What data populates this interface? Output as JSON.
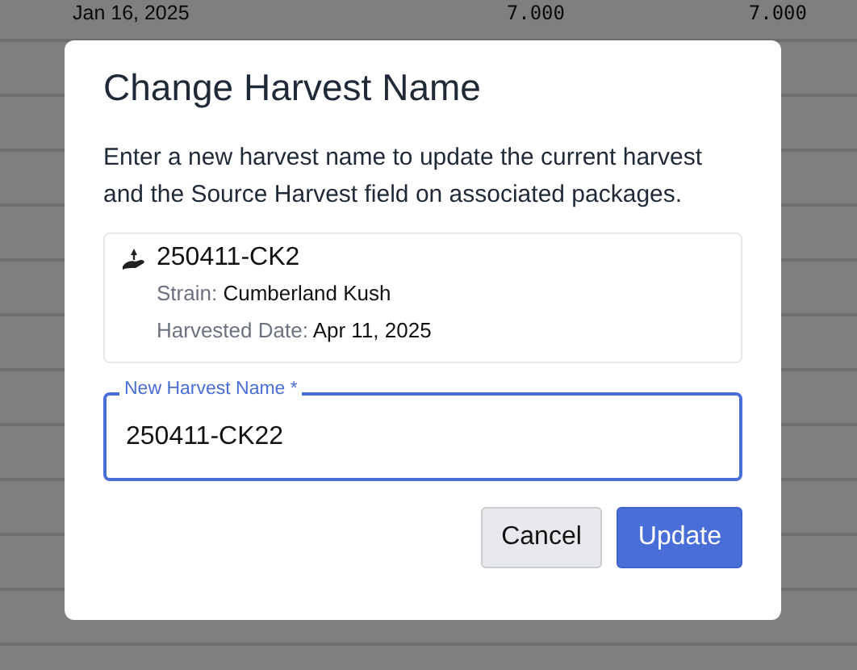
{
  "background_table": {
    "rows": [
      {
        "date": "Jan 16, 2025",
        "column_2": "7.000",
        "column_3": "7.000"
      }
    ]
  },
  "dialog": {
    "title": "Change Harvest Name",
    "description": "Enter a new harvest name to update the current harvest and the Source Harvest field on associated packages.",
    "harvest": {
      "name": "250411-CK2",
      "details": [
        {
          "label": "Strain:",
          "value": "Cumberland Kush"
        },
        {
          "label": "Harvested Date:",
          "value": "Apr 11, 2025"
        }
      ]
    },
    "field": {
      "label": "New Harvest Name *",
      "value": "250411-CK22",
      "focused": true
    },
    "buttons": [
      {
        "label": "Cancel",
        "kind": "secondary"
      },
      {
        "label": "Update",
        "kind": "primary"
      }
    ]
  }
}
